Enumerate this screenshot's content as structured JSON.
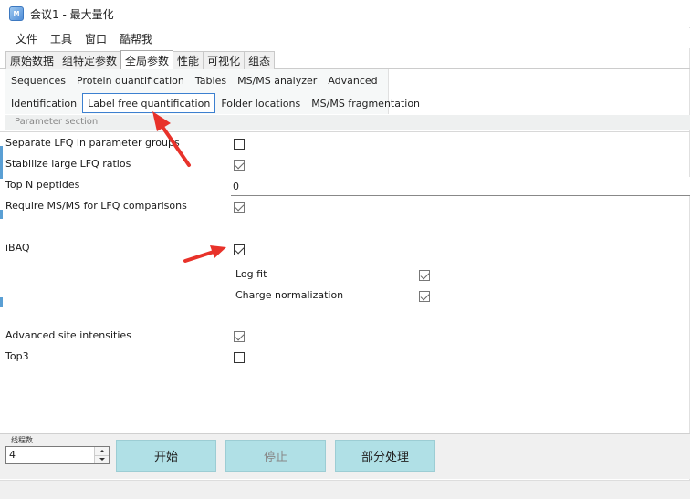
{
  "window": {
    "title": "会议1 - 最大量化",
    "icon": "app-logo-icon"
  },
  "menu": [
    "文件",
    "工具",
    "窗口",
    "酷帮我"
  ],
  "tabs": [
    "原始数据",
    "组特定参数",
    "全局参数",
    "性能",
    "可视化",
    "组态"
  ],
  "subtabs_row1": [
    "Sequences",
    "Protein quantification",
    "Tables",
    "MS/MS analyzer",
    "Advanced"
  ],
  "subtabs_row2": [
    "Identification",
    "Label free quantification",
    "Folder locations",
    "MS/MS fragmentation"
  ],
  "section_header": "Parameter section",
  "params": {
    "separate_lfq": {
      "label": "Separate LFQ in parameter groups",
      "checked": false
    },
    "stabilize_lfq": {
      "label": "Stabilize large LFQ ratios",
      "checked": true
    },
    "top_n": {
      "label": "Top N peptides",
      "value": "0"
    },
    "require_msms": {
      "label": "Require MS/MS for LFQ comparisons",
      "checked": true
    },
    "ibaq": {
      "label": "iBAQ",
      "checked": true
    },
    "log_fit": {
      "label": "Log fit",
      "checked": true
    },
    "charge_norm": {
      "label": "Charge normalization",
      "checked": true
    },
    "adv_site": {
      "label": "Advanced site intensities",
      "checked": true
    },
    "top3": {
      "label": "Top3",
      "checked": false
    }
  },
  "bottom": {
    "threads_label": "线程数",
    "threads_value": "4",
    "start_label": "开始",
    "stop_label": "停止",
    "partial_label": "部分处理"
  },
  "colors": {
    "button": "#b0e0e6",
    "arrow": "#e8322a",
    "active_tab_border": "#3c80d0"
  }
}
